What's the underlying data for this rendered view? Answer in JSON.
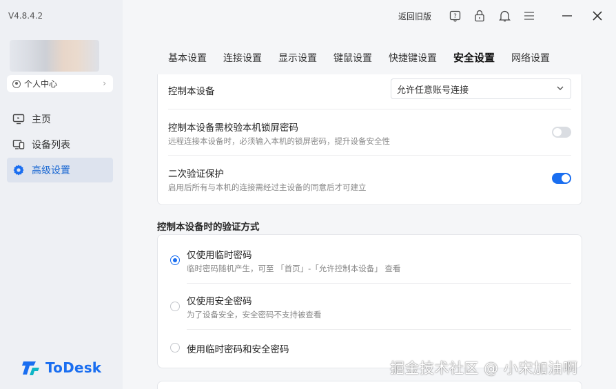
{
  "app": {
    "version": "V4.8.4.2",
    "personal_center": "个人中心",
    "colors": {
      "accent": "#1a6ef0",
      "sidebar_bg": "#eef0f4",
      "active_bg": "#dde3ee"
    }
  },
  "sidebar": {
    "items": [
      {
        "label": "主页",
        "icon": "monitor-icon",
        "active": false
      },
      {
        "label": "设备列表",
        "icon": "device-list-icon",
        "active": false
      },
      {
        "label": "高级设置",
        "icon": "gear-icon",
        "active": true
      }
    ],
    "logo_text": "ToDesk"
  },
  "topbar": {
    "back_to_old": "返回旧版",
    "icons": [
      "help-icon",
      "lock-icon",
      "bell-icon",
      "menu-icon",
      "minimize-icon",
      "close-icon"
    ]
  },
  "tabs": [
    {
      "label": "基本设置",
      "active": false
    },
    {
      "label": "连接设置",
      "active": false
    },
    {
      "label": "显示设置",
      "active": false
    },
    {
      "label": "键鼠设置",
      "active": false
    },
    {
      "label": "快捷键设置",
      "active": false
    },
    {
      "label": "安全设置",
      "active": true
    },
    {
      "label": "网络设置",
      "active": false
    }
  ],
  "security": {
    "control_device": {
      "label": "控制本设备",
      "value": "允许任意账号连接"
    },
    "lock_password": {
      "title": "控制本设备需校验本机锁屏密码",
      "desc": "远程连接本设备时，必须输入本机的锁屏密码，提升设备安全性",
      "enabled": false
    },
    "second_verify": {
      "title": "二次验证保护",
      "desc": "启用后所有与本机的连接需经过主设备的同意后才可建立",
      "enabled": true
    }
  },
  "verify_method": {
    "section_title": "控制本设备时的验证方式",
    "options": [
      {
        "title": "仅使用临时密码",
        "desc": "临时密码随机产生，可至 「首页」-「允许控制本设备」 查看",
        "checked": true
      },
      {
        "title": "仅使用安全密码",
        "desc": "为了设备安全，安全密码不支持被查看",
        "checked": false
      },
      {
        "title": "使用临时密码和安全密码",
        "desc": "",
        "checked": false
      }
    ]
  },
  "watermark": "掘金技术社区 @ 小宋加油啊"
}
